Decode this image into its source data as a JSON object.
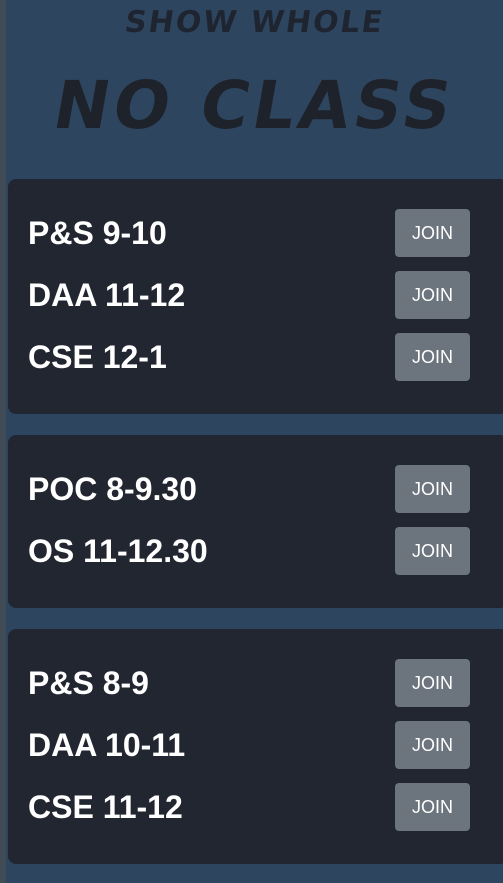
{
  "header": {
    "subtitle": "SHOW WHOLE",
    "title": "NO CLASS"
  },
  "days": [
    {
      "classes": [
        {
          "label": "P&S 9-10",
          "button": "JOIN"
        },
        {
          "label": "DAA 11-12",
          "button": "JOIN"
        },
        {
          "label": "CSE 12-1",
          "button": "JOIN"
        }
      ]
    },
    {
      "classes": [
        {
          "label": "POC 8-9.30",
          "button": "JOIN"
        },
        {
          "label": "OS 11-12.30",
          "button": "JOIN"
        }
      ]
    },
    {
      "classes": [
        {
          "label": "P&S 8-9",
          "button": "JOIN"
        },
        {
          "label": "DAA 10-11",
          "button": "JOIN"
        },
        {
          "label": "CSE 11-12",
          "button": "JOIN"
        }
      ]
    }
  ],
  "colors": {
    "page_background": "#2e4560",
    "card_background": "#212630",
    "button_background": "#6c757d",
    "text": "#ffffff",
    "header_text": "#1e232b"
  }
}
